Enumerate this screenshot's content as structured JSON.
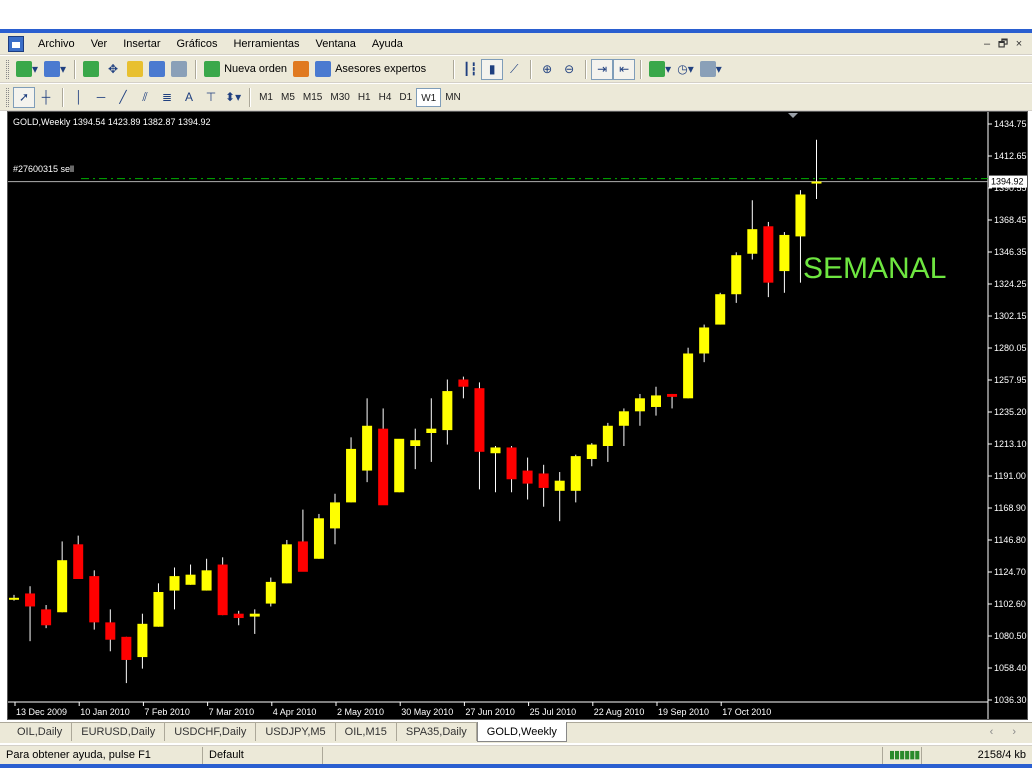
{
  "menu": {
    "items": [
      "Archivo",
      "Ver",
      "Insertar",
      "Gráficos",
      "Herramientas",
      "Ventana",
      "Ayuda"
    ],
    "window_controls": [
      "–",
      "🗗",
      "×"
    ]
  },
  "toolbar": {
    "new_order_label": "Nueva orden",
    "experts_label": "Asesores expertos",
    "timeframes": [
      "M1",
      "M5",
      "M15",
      "M30",
      "H1",
      "H4",
      "D1",
      "W1",
      "MN"
    ],
    "active_timeframe": "W1"
  },
  "chart": {
    "header": "GOLD,Weekly  1394.54 1423.89 1382.87 1394.92",
    "order_label": "#27600315 sell",
    "watermark": "SEMANAL",
    "current_price": "1394.92",
    "colors": {
      "bull": "#ffff00",
      "bear": "#ff0000",
      "background": "#000000",
      "order_line": "#00b000",
      "watermark": "#6ee640"
    }
  },
  "chart_data": {
    "type": "candlestick",
    "symbol": "GOLD",
    "timeframe": "Weekly",
    "y_ticks": [
      "1434.75",
      "1412.65",
      "1390.55",
      "1368.45",
      "1346.35",
      "1324.25",
      "1302.15",
      "1280.05",
      "1257.95",
      "1235.20",
      "1213.10",
      "1191.00",
      "1168.90",
      "1146.80",
      "1124.70",
      "1102.60",
      "1080.50",
      "1058.40",
      "1036.30"
    ],
    "x_labels": [
      "13 Dec 2009",
      "10 Jan 2010",
      "7 Feb 2010",
      "7 Mar 2010",
      "4 Apr 2010",
      "2 May 2010",
      "30 May 2010",
      "27 Jun 2010",
      "25 Jul 2010",
      "22 Aug 2010",
      "19 Sep 2010",
      "17 Oct 2010"
    ],
    "ylim": [
      1036.3,
      1434.75
    ],
    "order_price": 1397.0,
    "candles": [
      {
        "o": 1107,
        "h": 1109,
        "l": 1105,
        "c": 1107
      },
      {
        "o": 1110,
        "h": 1115,
        "l": 1077,
        "c": 1101
      },
      {
        "o": 1099,
        "h": 1102,
        "l": 1086,
        "c": 1088
      },
      {
        "o": 1097,
        "h": 1146,
        "l": 1097,
        "c": 1133
      },
      {
        "o": 1144,
        "h": 1150,
        "l": 1128,
        "c": 1120
      },
      {
        "o": 1122,
        "h": 1126,
        "l": 1085,
        "c": 1090
      },
      {
        "o": 1090,
        "h": 1099,
        "l": 1070,
        "c": 1078
      },
      {
        "o": 1080,
        "h": 1080,
        "l": 1048,
        "c": 1064
      },
      {
        "o": 1066,
        "h": 1096,
        "l": 1058,
        "c": 1089
      },
      {
        "o": 1087,
        "h": 1117,
        "l": 1087,
        "c": 1111
      },
      {
        "o": 1112,
        "h": 1128,
        "l": 1099,
        "c": 1122
      },
      {
        "o": 1116,
        "h": 1130,
        "l": 1116,
        "c": 1123
      },
      {
        "o": 1112,
        "h": 1134,
        "l": 1112,
        "c": 1126
      },
      {
        "o": 1130,
        "h": 1135,
        "l": 1095,
        "c": 1095
      },
      {
        "o": 1096,
        "h": 1098,
        "l": 1088,
        "c": 1093
      },
      {
        "o": 1094,
        "h": 1099,
        "l": 1082,
        "c": 1096
      },
      {
        "o": 1103,
        "h": 1121,
        "l": 1101,
        "c": 1118
      },
      {
        "o": 1117,
        "h": 1147,
        "l": 1117,
        "c": 1144
      },
      {
        "o": 1146,
        "h": 1168,
        "l": 1128,
        "c": 1125
      },
      {
        "o": 1134,
        "h": 1165,
        "l": 1134,
        "c": 1162
      },
      {
        "o": 1155,
        "h": 1179,
        "l": 1144,
        "c": 1173
      },
      {
        "o": 1173,
        "h": 1218,
        "l": 1173,
        "c": 1210
      },
      {
        "o": 1195,
        "h": 1245,
        "l": 1187,
        "c": 1226
      },
      {
        "o": 1224,
        "h": 1238,
        "l": 1174,
        "c": 1171
      },
      {
        "o": 1180,
        "h": 1216,
        "l": 1180,
        "c": 1217
      },
      {
        "o": 1212,
        "h": 1224,
        "l": 1196,
        "c": 1216
      },
      {
        "o": 1221,
        "h": 1245,
        "l": 1201,
        "c": 1224
      },
      {
        "o": 1223,
        "h": 1258,
        "l": 1213,
        "c": 1250
      },
      {
        "o": 1258,
        "h": 1260,
        "l": 1245,
        "c": 1253
      },
      {
        "o": 1252,
        "h": 1256,
        "l": 1182,
        "c": 1208
      },
      {
        "o": 1207,
        "h": 1212,
        "l": 1180,
        "c": 1211
      },
      {
        "o": 1211,
        "h": 1212,
        "l": 1180,
        "c": 1189
      },
      {
        "o": 1195,
        "h": 1204,
        "l": 1175,
        "c": 1186
      },
      {
        "o": 1193,
        "h": 1199,
        "l": 1170,
        "c": 1183
      },
      {
        "o": 1181,
        "h": 1194,
        "l": 1160,
        "c": 1188
      },
      {
        "o": 1181,
        "h": 1206,
        "l": 1173,
        "c": 1205
      },
      {
        "o": 1203,
        "h": 1214,
        "l": 1198,
        "c": 1213
      },
      {
        "o": 1212,
        "h": 1228,
        "l": 1201,
        "c": 1226
      },
      {
        "o": 1226,
        "h": 1238,
        "l": 1212,
        "c": 1236
      },
      {
        "o": 1236,
        "h": 1248,
        "l": 1226,
        "c": 1245
      },
      {
        "o": 1239,
        "h": 1253,
        "l": 1233,
        "c": 1247
      },
      {
        "o": 1248,
        "h": 1248,
        "l": 1238,
        "c": 1246
      },
      {
        "o": 1245,
        "h": 1280,
        "l": 1245,
        "c": 1276
      },
      {
        "o": 1276,
        "h": 1296,
        "l": 1270,
        "c": 1294
      },
      {
        "o": 1296,
        "h": 1318,
        "l": 1296,
        "c": 1317
      },
      {
        "o": 1317,
        "h": 1346,
        "l": 1311,
        "c": 1344
      },
      {
        "o": 1345,
        "h": 1382,
        "l": 1341,
        "c": 1362
      },
      {
        "o": 1364,
        "h": 1367,
        "l": 1315,
        "c": 1325
      },
      {
        "o": 1333,
        "h": 1360,
        "l": 1318,
        "c": 1358
      },
      {
        "o": 1357,
        "h": 1389,
        "l": 1325,
        "c": 1386
      },
      {
        "o": 1394.54,
        "h": 1423.89,
        "l": 1382.87,
        "c": 1394.92
      }
    ]
  },
  "tabs": [
    "OIL,Daily",
    "EURUSD,Daily",
    "USDCHF,Daily",
    "USDJPY,M5",
    "OIL,M15",
    "SPA35,Daily",
    "GOLD,Weekly"
  ],
  "active_tab": "GOLD,Weekly",
  "tab_nav": "‹ ›",
  "status": {
    "help": "Para obtener ayuda, pulse F1",
    "profile": "Default",
    "traffic": "2158/4 kb"
  }
}
